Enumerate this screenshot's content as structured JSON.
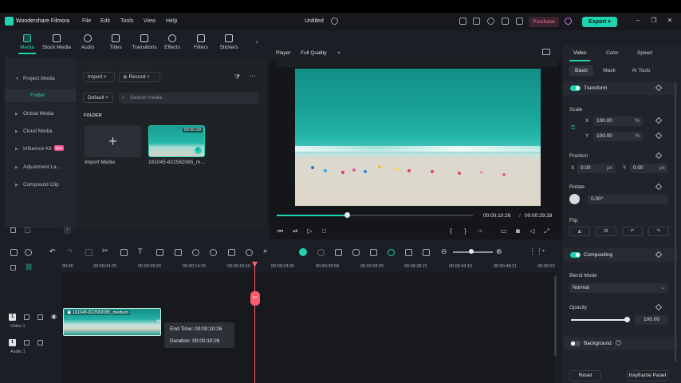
{
  "titlebar": {
    "app_name": "Wondershare Filmora",
    "menu": [
      "File",
      "Edit",
      "Tools",
      "View",
      "Help"
    ],
    "doc_title": "Untitled",
    "purchase_label": "Purchase",
    "export_label": "Export"
  },
  "media_toolbar": {
    "items": [
      {
        "label": "Media",
        "icon": "media-icon",
        "active": true
      },
      {
        "label": "Stock Media",
        "icon": "stock-media-icon"
      },
      {
        "label": "Audio",
        "icon": "music-note-icon"
      },
      {
        "label": "Titles",
        "icon": "text-t-icon"
      },
      {
        "label": "Transitions",
        "icon": "transitions-icon"
      },
      {
        "label": "Effects",
        "icon": "effects-icon"
      },
      {
        "label": "Filters",
        "icon": "filters-icon"
      },
      {
        "label": "Stickers",
        "icon": "stickers-icon"
      }
    ]
  },
  "sidebar": {
    "items": [
      {
        "label": "Project Media"
      },
      {
        "label": "Folder"
      },
      {
        "label": "Global Media"
      },
      {
        "label": "Cloud Media"
      },
      {
        "label": "Influence Kit",
        "badge": "Beta"
      },
      {
        "label": "Adjustment La..."
      },
      {
        "label": "Compound Clip"
      }
    ]
  },
  "bin": {
    "import_label": "Import",
    "record_label": "Record",
    "sort_label": "Default",
    "search_placeholder": "Search media",
    "folder_heading": "FOLDER",
    "import_tile_label": "Import Media",
    "clip_name": "161045-822582085_m...",
    "clip_duration": "00:00:29"
  },
  "player": {
    "label": "Player",
    "quality": "Full Quality",
    "current_time": "00:00:10:26",
    "total_time": "00:00:29:28",
    "progress": 0.36,
    "separator": "/"
  },
  "right_panel": {
    "tabs": [
      "Video",
      "Color",
      "Speed"
    ],
    "subtabs": [
      "Basic",
      "Mask",
      "AI Tools"
    ],
    "transform_label": "Transform",
    "scale_label": "Scale",
    "scale_x_axis": "X",
    "scale_x": "100.00",
    "scale_y_axis": "Y",
    "scale_y": "100.00",
    "percent": "%",
    "position_label": "Position",
    "pos_x_axis": "X",
    "pos_x": "0.00",
    "pos_y_axis": "Y",
    "pos_y": "0.00",
    "px": "px",
    "rotate_label": "Rotate",
    "rotate_value": "0.00°",
    "flip_label": "Flip",
    "compositing_label": "Compositing",
    "blend_mode_label": "Blend Mode",
    "blend_mode_value": "Normal",
    "opacity_label": "Opacity",
    "opacity_value": "100.00",
    "opacity_level": 1.0,
    "background_label": "Background",
    "reset_label": "Reset",
    "keyframe_label": "Keyframe Panel"
  },
  "timeline": {
    "ticks": [
      "00:00",
      "00:00:04:25",
      "00:00:09:20",
      "00:00:14:15",
      "00:00:19:10",
      "00:00:24:05",
      "00:00:29:00",
      "00:00:33:25",
      "00:00:38:21",
      "00:00:43:16",
      "00:00:48:11",
      "00:00:53:"
    ],
    "video_track_label": "Video 1",
    "audio_track_label": "Audio 1",
    "video_track_number": "1",
    "audio_track_number": "1",
    "clip_label": "161045-822582085_medium",
    "tooltip_end_label": "End Time:",
    "tooltip_end_value": "00:00:10:26",
    "tooltip_duration_label": "Duration:",
    "tooltip_duration_value": "00:00:10:26"
  },
  "colors": {
    "accent": "#1fd3b0",
    "playhead": "#ff5a6e",
    "purchase": "#ff6a8c"
  }
}
